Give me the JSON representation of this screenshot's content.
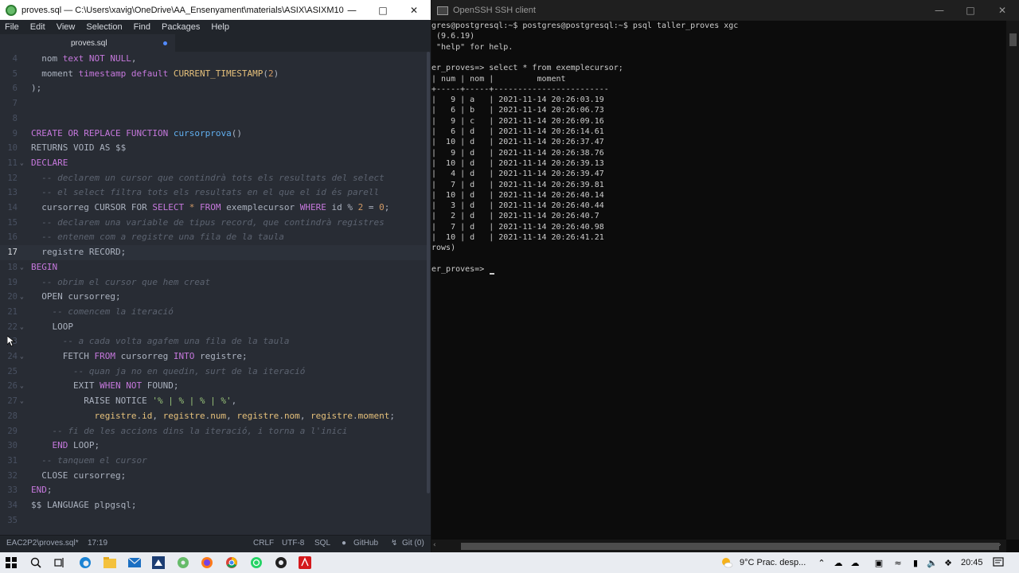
{
  "editor": {
    "title": "proves.sql — C:\\Users\\xavig\\OneDrive\\AA_Ensenyament\\materials\\ASIX\\ASIXM10-ASGB...",
    "menu": [
      "File",
      "Edit",
      "View",
      "Selection",
      "Find",
      "Packages",
      "Help"
    ],
    "tab_label": "proves.sql",
    "line_numbers": [
      "4",
      "5",
      "6",
      "7",
      "8",
      "9",
      "10",
      "11",
      "12",
      "13",
      "14",
      "15",
      "16",
      "17",
      "18",
      "19",
      "20",
      "21",
      "22",
      "23",
      "24",
      "25",
      "26",
      "27",
      "28",
      "29",
      "30",
      "31",
      "32",
      "33",
      "34",
      "35"
    ],
    "current_line": "17",
    "status": {
      "file": "EAC2P2\\proves.sql*",
      "position": "17:19",
      "line_ending": "CRLF",
      "encoding": "UTF-8",
      "grammar": "SQL",
      "github": "GitHub",
      "git": "Git (0)"
    }
  },
  "terminal": {
    "title": "OpenSSH SSH client",
    "lines": [
      "gres@postgresql:~$ postgres@postgresql:~$ psql taller_proves xgc",
      " (9.6.19)",
      " \"help\" for help.",
      "",
      "er_proves=> select * from exemplecursor;",
      "| num | nom |         moment",
      "+-----+-----+------------------------",
      "|   9 | a   | 2021-11-14 20:26:03.19",
      "|   6 | b   | 2021-11-14 20:26:06.73",
      "|   9 | c   | 2021-11-14 20:26:09.16",
      "|   6 | d   | 2021-11-14 20:26:14.61",
      "|  10 | d   | 2021-11-14 20:26:37.47",
      "|   9 | d   | 2021-11-14 20:26:38.76",
      "|  10 | d   | 2021-11-14 20:26:39.13",
      "|   4 | d   | 2021-11-14 20:26:39.47",
      "|   7 | d   | 2021-11-14 20:26:39.81",
      "|  10 | d   | 2021-11-14 20:26:40.14",
      "|   3 | d   | 2021-11-14 20:26:40.44",
      "|   2 | d   | 2021-11-14 20:26:40.7",
      "|   7 | d   | 2021-11-14 20:26:40.98",
      "|  10 | d   | 2021-11-14 20:26:41.21",
      "rows)",
      "",
      "er_proves=> "
    ]
  },
  "taskbar": {
    "weather": "9°C  Prac. desp...",
    "time": "20:45"
  }
}
